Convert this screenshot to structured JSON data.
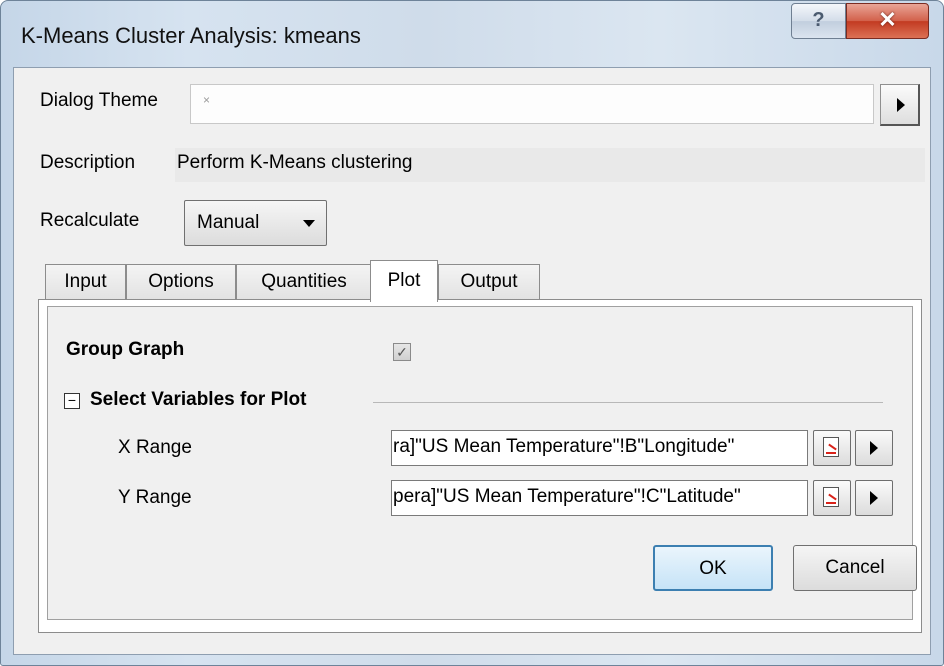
{
  "window": {
    "title": "K-Means Cluster Analysis: kmeans",
    "help_glyph": "?",
    "close_glyph": "✕"
  },
  "dialog_theme": {
    "label": "Dialog Theme",
    "value": "×"
  },
  "description": {
    "label": "Description",
    "value": "Perform K-Means clustering"
  },
  "recalculate": {
    "label": "Recalculate",
    "value": "Manual"
  },
  "tabs": [
    {
      "label": "Input"
    },
    {
      "label": "Options"
    },
    {
      "label": "Quantities"
    },
    {
      "label": "Plot",
      "active": true
    },
    {
      "label": "Output"
    }
  ],
  "plot": {
    "group_graph_label": "Group Graph",
    "group_graph_checked": true,
    "check_glyph": "✓",
    "section_title": "Select Variables for Plot",
    "expander_glyph": "−",
    "x_range": {
      "label": "X Range",
      "value": "ra]\"US Mean Temperature\"!B\"Longitude\""
    },
    "y_range": {
      "label": "Y Range",
      "value": "pera]\"US Mean Temperature\"!C\"Latitude\""
    }
  },
  "buttons": {
    "ok": "OK",
    "cancel": "Cancel"
  },
  "icons": {
    "help": "help-icon",
    "close": "close-icon",
    "expand_menu": "triangle-right-icon",
    "dropdown": "chevron-down-icon",
    "range_picker": "select-range-icon"
  },
  "colors": {
    "close_button": "#c23a21",
    "default_button_border": "#3c7fb1",
    "picker_accent": "#d9231a"
  }
}
